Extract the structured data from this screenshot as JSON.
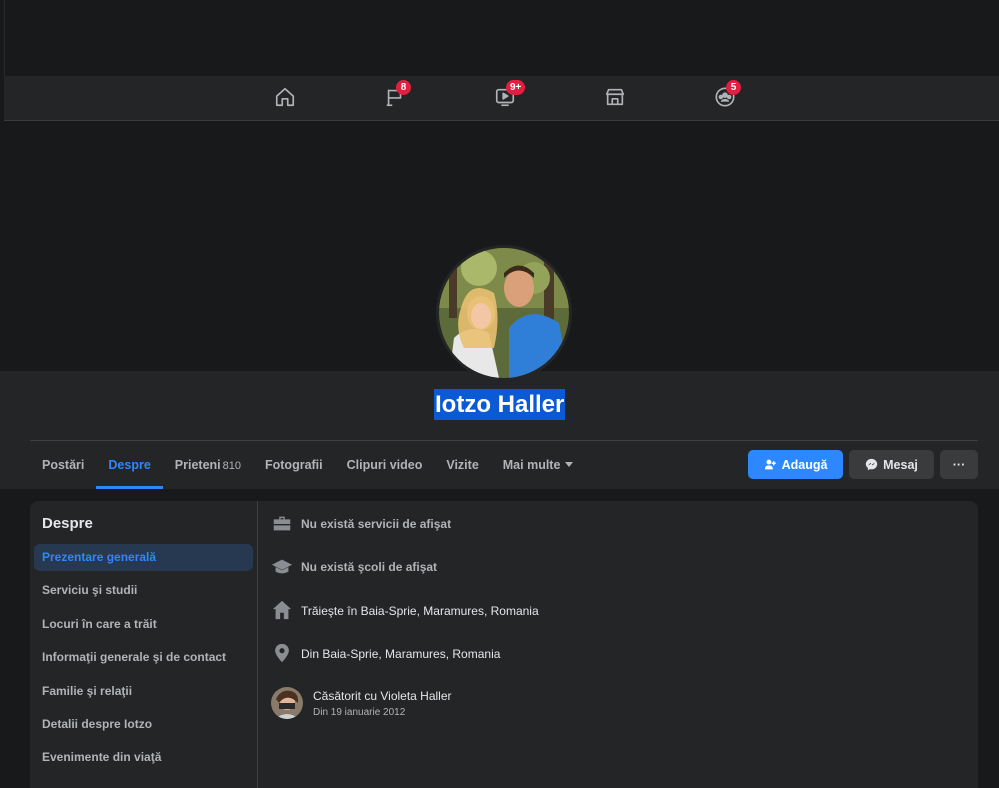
{
  "nav": {
    "icons": [
      {
        "name": "home-icon",
        "badge": ""
      },
      {
        "name": "pages-flag-icon",
        "badge": "8"
      },
      {
        "name": "watch-video-icon",
        "badge": "9+"
      },
      {
        "name": "marketplace-icon",
        "badge": ""
      },
      {
        "name": "groups-icon",
        "badge": "5"
      }
    ]
  },
  "profile": {
    "name": "Iotzo Haller"
  },
  "tabs": [
    {
      "label": "Postări",
      "count": ""
    },
    {
      "label": "Despre",
      "count": ""
    },
    {
      "label": "Prieteni",
      "count": "810"
    },
    {
      "label": "Fotografii",
      "count": ""
    },
    {
      "label": "Clipuri video",
      "count": ""
    },
    {
      "label": "Vizite",
      "count": ""
    },
    {
      "label": "Mai multe",
      "count": ""
    }
  ],
  "actions": {
    "add_label": "Adaugă",
    "message_label": "Mesaj",
    "more_label": "···"
  },
  "about": {
    "title": "Despre",
    "menu": [
      "Prezentare generală",
      "Serviciu şi studii",
      "Locuri în care a trăit",
      "Informaţii generale şi de contact",
      "Familie şi relaţii",
      "Detalii despre Iotzo",
      "Evenimente din viaţă"
    ],
    "rows": [
      {
        "icon": "work-briefcase-icon",
        "text": "Nu există servicii de afişat"
      },
      {
        "icon": "education-cap-icon",
        "text": "Nu există şcoli de afişat"
      },
      {
        "icon": "home-house-icon",
        "text": "Trăieşte în Baia-Sprie, Maramures, Romania"
      },
      {
        "icon": "location-pin-icon",
        "text": "Din Baia-Sprie, Maramures, Romania"
      }
    ],
    "relationship": {
      "text": "Căsătorit cu Violeta Haller",
      "since": "Din 19 ianuarie 2012"
    }
  },
  "colors": {
    "accent": "#2d88ff",
    "badge": "#e41e3f",
    "surface": "#242526",
    "background": "#18191a",
    "name_highlight": "#0a5ad6"
  }
}
